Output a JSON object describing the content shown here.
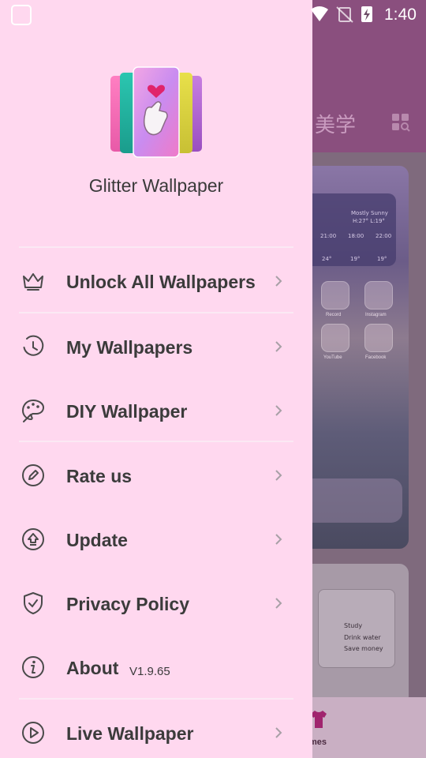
{
  "status_bar": {
    "time": "1:40"
  },
  "background_app": {
    "title": "美学",
    "widget": {
      "weather": "Mostly Sunny",
      "range": "H:27° L:19°",
      "hours": [
        "21:00",
        "18:00",
        "22:00"
      ],
      "temps": [
        "24°",
        "19°",
        "19°"
      ]
    },
    "apps": [
      "Record",
      "Instagram",
      "YouTube",
      "Facebook"
    ],
    "todo": [
      "Study",
      "Drink water",
      "Save money"
    ],
    "nav_label": "mes"
  },
  "drawer": {
    "app_name": "Glitter Wallpaper",
    "menu": [
      {
        "label": "Unlock All Wallpapers",
        "icon": "crown-icon"
      },
      {
        "label": "My Wallpapers",
        "icon": "history-clock-icon"
      },
      {
        "label": "DIY Wallpaper",
        "icon": "palette-icon"
      },
      {
        "label": "Rate us",
        "icon": "edit-pencil-icon"
      },
      {
        "label": "Update",
        "icon": "upload-arrow-icon"
      },
      {
        "label": "Privacy Policy",
        "icon": "shield-check-icon"
      },
      {
        "label": "About",
        "icon": "info-icon",
        "version": "V1.9.65"
      },
      {
        "label": "Live Wallpaper",
        "icon": "play-circle-icon"
      }
    ]
  },
  "colors": {
    "drawer_bg": "#ffd8ef",
    "text": "#3b3b3b",
    "icon": "#4a4a4a",
    "divider": "#fbe9f4"
  }
}
